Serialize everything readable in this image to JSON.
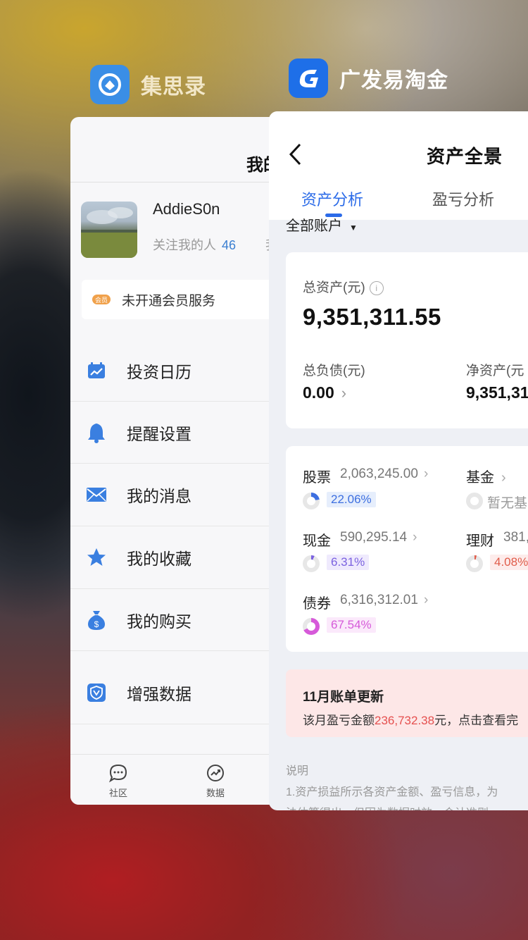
{
  "app1": {
    "name": "集思录",
    "nav_title": "我的",
    "profile": {
      "username": "AddieS0n",
      "follow_label": "关注我的人",
      "follow_count": "46",
      "extra_char": "我"
    },
    "member": {
      "badge": "会员",
      "text": "未开通会员服务"
    },
    "menu": [
      {
        "label": "投资日历",
        "icon": "calendar-chart-icon"
      },
      {
        "label": "提醒设置",
        "icon": "bell-icon"
      },
      {
        "label": "我的消息",
        "icon": "envelope-icon"
      },
      {
        "label": "我的收藏",
        "icon": "star-icon"
      },
      {
        "label": "我的购买",
        "icon": "money-bag-icon"
      },
      {
        "label": "增强数据",
        "icon": "shield-v-icon"
      }
    ],
    "tabs": [
      {
        "label": "社区",
        "icon": "chat-bubble-icon"
      },
      {
        "label": "数据",
        "icon": "trend-chart-icon"
      }
    ]
  },
  "app2": {
    "name": "广发易淘金",
    "title": "资产全景",
    "tabs": [
      "资产分析",
      "盈亏分析"
    ],
    "account_filter": "全部账户",
    "summary": {
      "total_label": "总资产(元)",
      "total_value": "9,351,311.55",
      "liability_label": "总负债(元)",
      "liability_value": "0.00",
      "net_label": "净资产(元",
      "net_value": "9,351,31"
    },
    "assets": [
      {
        "name": "股票",
        "value": "2,063,245.00",
        "pct": "22.06%",
        "pct_color": "#3d6fe0",
        "pct_bg": "#e6eefc",
        "share": 0.2206
      },
      {
        "name": "基金",
        "value": "",
        "pct": "暂无基",
        "pct_color": "#999999",
        "pct_bg": "#ffffff",
        "share": 0
      },
      {
        "name": "现金",
        "value": "590,295.14",
        "pct": "6.31%",
        "pct_color": "#7b62e0",
        "pct_bg": "#efeafd",
        "share": 0.0631
      },
      {
        "name": "理财",
        "value": "381,",
        "pct": "4.08%",
        "pct_color": "#e05c4a",
        "pct_bg": "#fdeceb",
        "share": 0.0408
      },
      {
        "name": "债券",
        "value": "6,316,312.01",
        "pct": "67.54%",
        "pct_color": "#d65ad9",
        "pct_bg": "#fbe9fb",
        "share": 0.6754
      }
    ],
    "notice": {
      "title": "11月账单更新",
      "prefix": "该月盈亏金额",
      "amount": "236,732.38",
      "suffix": "元，点击查看完"
    },
    "note": {
      "title": "说明",
      "line1": "1.资产损益所示各资产金额、盈亏信息，为",
      "line2": "法估算得出，但因为数据时效、会计准则"
    }
  },
  "colors": {
    "accent_blue": "#2b6be8",
    "loss_red": "#e5504f"
  }
}
